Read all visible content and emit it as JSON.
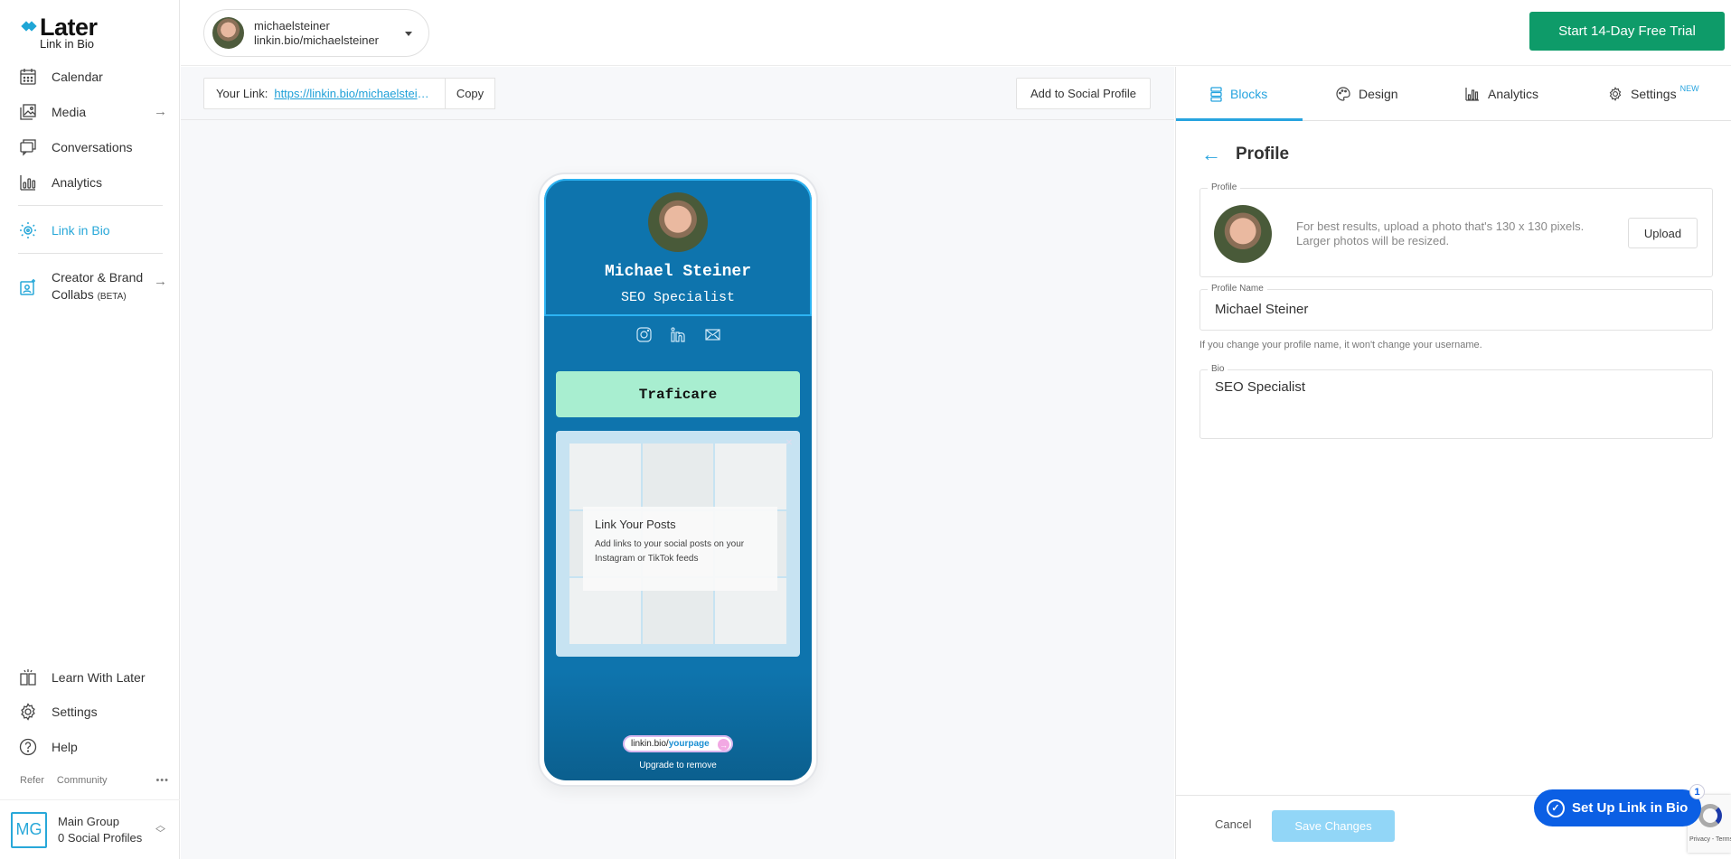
{
  "sidebar": {
    "logo": {
      "title": "Later",
      "subtitle": "Link in Bio"
    },
    "items": [
      {
        "label": "Calendar",
        "icon": "calendar-icon"
      },
      {
        "label": "Media",
        "icon": "media-icon",
        "arrow": "→"
      },
      {
        "label": "Conversations",
        "icon": "conversations-icon"
      },
      {
        "label": "Analytics",
        "icon": "analytics-icon"
      },
      {
        "label": "Link in Bio",
        "icon": "link-in-bio-icon",
        "active": true
      },
      {
        "label": "Creator & Brand",
        "label2": "Collabs",
        "badge": "(BETA)",
        "icon": "collabs-icon",
        "arrow": "→"
      }
    ],
    "bottom_items": [
      {
        "label": "Learn With Later",
        "icon": "book-icon"
      },
      {
        "label": "Settings",
        "icon": "gear-icon"
      },
      {
        "label": "Help",
        "icon": "help-icon"
      }
    ],
    "footer_links": {
      "refer": "Refer",
      "community": "Community",
      "more": "•••"
    },
    "group": {
      "initials": "MG",
      "name": "Main Group",
      "profiles": "0 Social Profiles"
    }
  },
  "header": {
    "account": {
      "username": "michaelsteiner",
      "url": "linkin.bio/michaelsteiner"
    },
    "trial_button": "Start 14-Day Free Trial"
  },
  "linkbar": {
    "label": "Your Link:",
    "url": "https://linkin.bio/michaelsteiner",
    "copy": "Copy",
    "add_social": "Add to Social Profile"
  },
  "phone": {
    "name": "Michael Steiner",
    "bio": "SEO Specialist",
    "socials": [
      "instagram-icon",
      "linkedin-icon",
      "mail-icon"
    ],
    "button": "Traficare",
    "posts_card": {
      "title": "Link Your Posts",
      "description": "Add links to your social posts on your Instagram or TikTok feeds",
      "close": "×"
    },
    "branding": {
      "prefix": "linkin.bio/",
      "highlight": "yourpage",
      "arrow": "→"
    },
    "upgrade": "Upgrade to remove"
  },
  "panel": {
    "tabs": [
      {
        "label": "Blocks",
        "active": true
      },
      {
        "label": "Design"
      },
      {
        "label": "Analytics"
      },
      {
        "label": "Settings",
        "badge": "NEW"
      }
    ],
    "back": "←",
    "title": "Profile",
    "profile_section": {
      "legend": "Profile",
      "hint_line1": "For best results, upload a photo that's 130 x 130 pixels.",
      "hint_line2": "Larger photos will be resized.",
      "upload": "Upload"
    },
    "profile_name": {
      "legend": "Profile Name",
      "value": "Michael Steiner",
      "help": "If you change your profile name, it won't change your username."
    },
    "bio": {
      "legend": "Bio",
      "value": "SEO Specialist"
    },
    "cancel": "Cancel",
    "save": "Save Changes"
  },
  "setup": {
    "label": "Set Up Link in Bio",
    "count": "1"
  },
  "recaptcha": {
    "text": "Privacy - Terms"
  },
  "colors": {
    "accent": "#27a4df",
    "trial": "#0e9b69",
    "phone_bg": "#0e74ad",
    "cta": "#a8eed0",
    "setup": "#0b5fe4",
    "save_disabled": "#92d6f7"
  }
}
